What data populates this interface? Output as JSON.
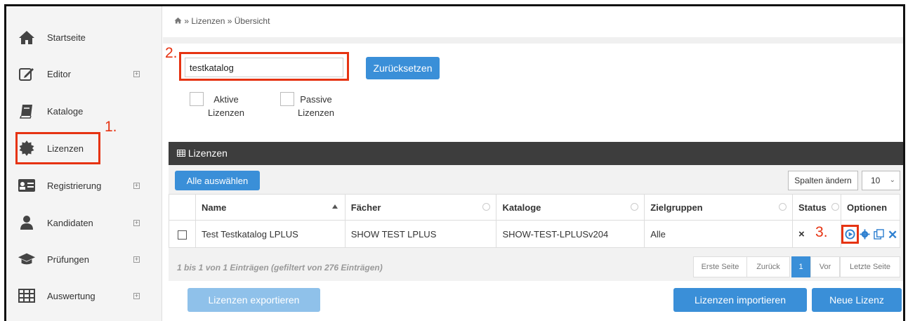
{
  "sidebar": {
    "items": [
      {
        "label": "Startseite",
        "icon": "home-icon",
        "expandable": false
      },
      {
        "label": "Editor",
        "icon": "edit-icon",
        "expandable": true
      },
      {
        "label": "Kataloge",
        "icon": "book-icon",
        "expandable": false
      },
      {
        "label": "Lizenzen",
        "icon": "badge-icon",
        "expandable": false
      },
      {
        "label": "Registrierung",
        "icon": "id-card-icon",
        "expandable": true
      },
      {
        "label": "Kandidaten",
        "icon": "user-icon",
        "expandable": true
      },
      {
        "label": "Prüfungen",
        "icon": "graduation-cap-icon",
        "expandable": true
      },
      {
        "label": "Auswertung",
        "icon": "table-icon",
        "expandable": true
      }
    ]
  },
  "annotations": {
    "step1": "1.",
    "step2": "2.",
    "step3": "3.",
    "color": "#e63312"
  },
  "breadcrumb": {
    "home_icon": "home-icon",
    "path": " » Lizenzen » Übersicht"
  },
  "filter": {
    "search_value": "testkatalog",
    "reset_label": "Zurücksetzen",
    "active_line1": "Aktive",
    "active_line2": "Lizenzen",
    "passive_line1": "Passive",
    "passive_line2": "Lizenzen"
  },
  "panel": {
    "title": "Lizenzen",
    "select_all_label": "Alle auswählen",
    "columns_button_label": "Spalten ändern",
    "page_size": "10"
  },
  "table": {
    "headers": [
      "Name",
      "Fächer",
      "Kataloge",
      "Zielgruppen",
      "Status",
      "Optionen"
    ],
    "rows": [
      {
        "name": "Test Testkatalog LPLUS",
        "faecher": "SHOW TEST LPLUS",
        "kataloge": "SHOW-TEST-LPLUSv204",
        "zielgruppen": "Alle",
        "status": "×"
      }
    ]
  },
  "footer": {
    "info": "1 bis 1 von 1 Einträgen (gefiltert von 276 Einträgen)",
    "pager": {
      "first": "Erste Seite",
      "prev": "Zurück",
      "current": "1",
      "next": "Vor",
      "last": "Letzte Seite"
    },
    "export_label": "Lizenzen exportieren",
    "import_label": "Lizenzen importieren",
    "new_label": "Neue Lizenz"
  },
  "colors": {
    "accent": "#3a8fd8",
    "header_dark": "#3d3d3d",
    "annotation": "#e63312"
  }
}
